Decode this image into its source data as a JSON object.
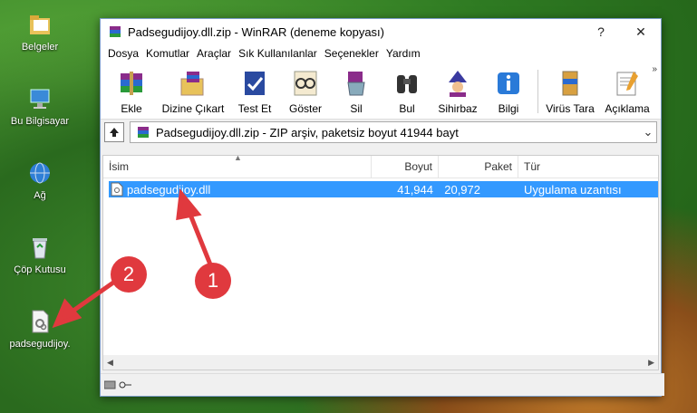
{
  "desktop": {
    "icons": [
      {
        "label": "Belgeler",
        "icon": "folder-icon"
      },
      {
        "label": "Bu Bilgisayar",
        "icon": "computer-icon"
      },
      {
        "label": "Ağ",
        "icon": "network-icon"
      },
      {
        "label": "Çöp Kutusu",
        "icon": "recycle-bin-icon"
      },
      {
        "label": "padsegudijoy.",
        "icon": "dll-file-icon"
      }
    ]
  },
  "window": {
    "title": "Padsegudijoy.dll.zip - WinRAR (deneme kopyası)",
    "help_btn": "?",
    "close_btn": "✕",
    "minimize_btn": "—",
    "menu": [
      "Dosya",
      "Komutlar",
      "Araçlar",
      "Sık Kullanılanlar",
      "Seçenekler",
      "Yardım"
    ],
    "toolbar": [
      "Ekle",
      "Dizine Çıkart",
      "Test Et",
      "Göster",
      "Sil",
      "Bul",
      "Sihirbaz",
      "Bilgi",
      "Virüs Tara",
      "Açıklama"
    ],
    "toolbar_more": "»",
    "address": "Padsegudijoy.dll.zip - ZIP arşiv, paketsiz boyut 41944 bayt",
    "columns": [
      "İsim",
      "Boyut",
      "Paket",
      "Tür"
    ],
    "files": [
      {
        "name": "padsegudijoy.dll",
        "size": "41,944",
        "packed": "20,972",
        "type": "Uygulama uzantısı"
      }
    ]
  },
  "annotations": {
    "badge1": "1",
    "badge2": "2"
  },
  "colors": {
    "selection": "#3399ff",
    "badge": "#e0393e"
  }
}
